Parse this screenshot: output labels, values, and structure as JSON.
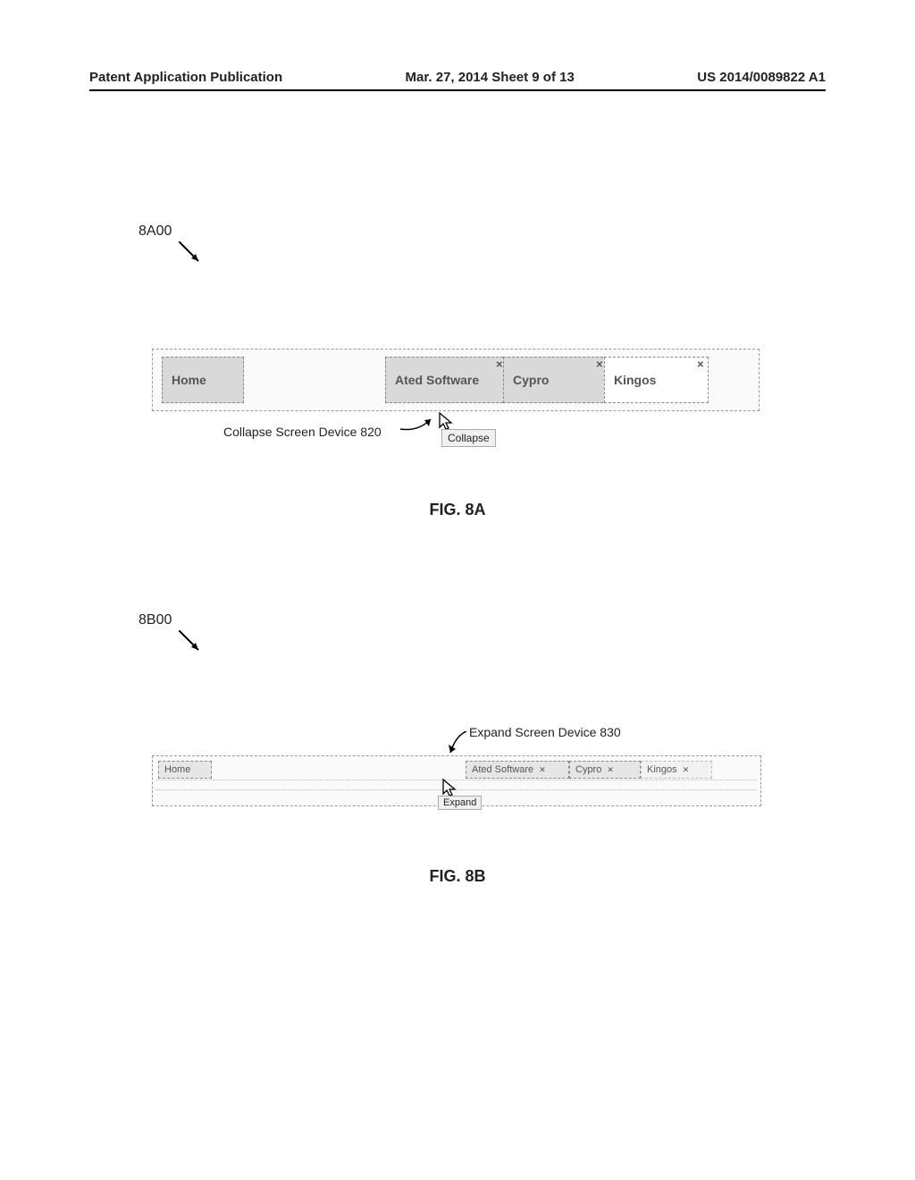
{
  "header": {
    "left": "Patent Application Publication",
    "center": "Mar. 27, 2014  Sheet 9 of 13",
    "right": "US 2014/0089822 A1"
  },
  "fig8a": {
    "ref": "8A00",
    "tabs": {
      "home": "Home",
      "ated": "Ated Software",
      "cypro": "Cypro",
      "kingos": "Kingos"
    },
    "callout": "Collapse Screen Device 820",
    "tooltip": "Collapse",
    "caption": "FIG. 8A"
  },
  "fig8b": {
    "ref": "8B00",
    "tabs": {
      "home": "Home",
      "ated": "Ated Software",
      "cypro": "Cypro",
      "kingos": "Kingos"
    },
    "callout": "Expand Screen Device 830",
    "tooltip": "Expand",
    "caption": "FIG. 8B"
  },
  "glyphs": {
    "close": "✕"
  }
}
